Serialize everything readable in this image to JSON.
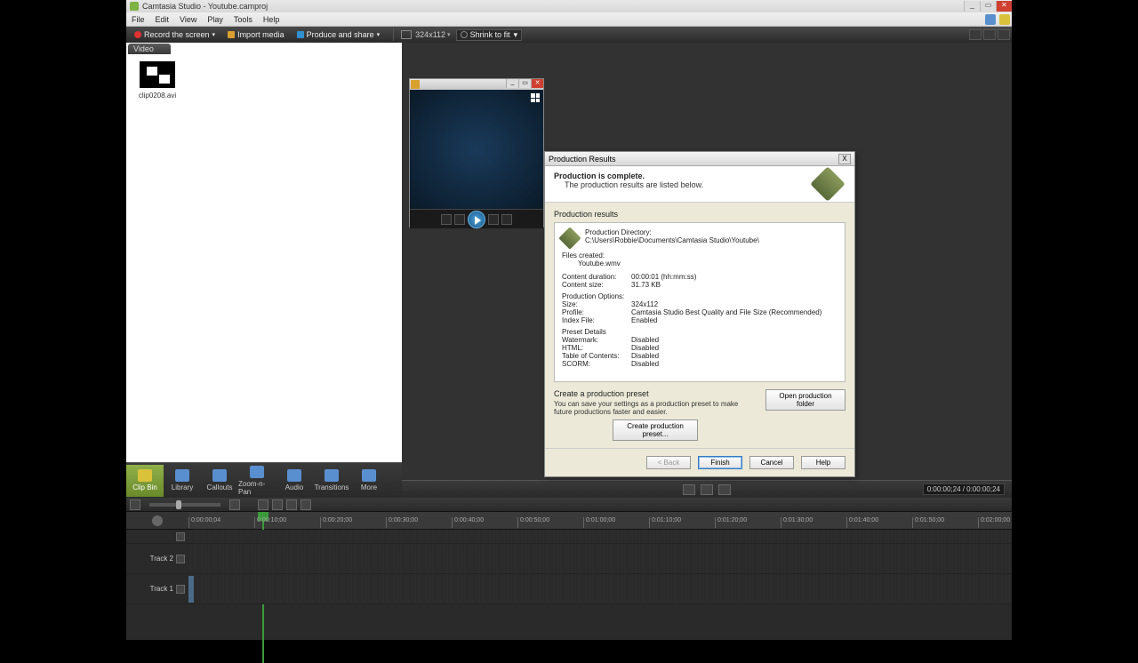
{
  "titlebar": {
    "text": "Camtasia Studio - Youtube.camproj"
  },
  "menu": {
    "file": "File",
    "edit": "Edit",
    "view": "View",
    "play": "Play",
    "tools": "Tools",
    "help": "Help"
  },
  "toolbar": {
    "record": "Record the screen",
    "import": "Import media",
    "produce": "Produce and share",
    "dimensions": "324x112",
    "zoom": "Shrink to fit"
  },
  "clipbin": {
    "tab": "Video",
    "clip_name": "clip0208.avi"
  },
  "tabs": {
    "clipbin": "Clip Bin",
    "library": "Library",
    "callouts": "Callouts",
    "zoom": "Zoom-n-Pan",
    "audio": "Audio",
    "transitions": "Transitions",
    "more": "More"
  },
  "preview": {
    "time": "0:00:00;24 / 0:00:00;24"
  },
  "dialog": {
    "title": "Production Results",
    "heading": "Production is complete.",
    "subheading": "The production results are listed below.",
    "results_label": "Production results",
    "dir_label": "Production Directory:",
    "dir_value": "C:\\Users\\Robbie\\Documents\\Camtasia Studio\\Youtube\\",
    "files_label": "Files created:",
    "files_value": "Youtube.wmv",
    "duration_label": "Content duration:",
    "duration_value": "00:00:01 (hh:mm:ss)",
    "size_label": "Content size:",
    "size_value": "31.73 KB",
    "options_label": "Production Options:",
    "opt_size_label": "Size:",
    "opt_size_value": "324x112",
    "opt_profile_label": "Profile:",
    "opt_profile_value": "Camtasia Studio Best Quality and File Size (Recommended)",
    "opt_index_label": "Index File:",
    "opt_index_value": "Enabled",
    "preset_label": "Preset Details",
    "watermark_label": "Watermark:",
    "watermark_value": "Disabled",
    "html_label": "HTML:",
    "html_value": "Disabled",
    "toc_label": "Table of Contents:",
    "toc_value": "Disabled",
    "scorm_label": "SCORM:",
    "scorm_value": "Disabled",
    "create_preset_heading": "Create a production preset",
    "create_preset_text": "You can save your settings as a production preset to make future productions faster and easier.",
    "open_folder": "Open production folder",
    "create_preset_btn": "Create production preset...",
    "back": "< Back",
    "finish": "Finish",
    "cancel": "Cancel",
    "help": "Help"
  },
  "timeline": {
    "tracks": {
      "t2": "Track 2",
      "t1": "Track 1"
    },
    "ticks": [
      "0:00:00;04",
      "0:00:10;00",
      "0:00:20;00",
      "0:00:30;00",
      "0:00:40;00",
      "0:00:50;00",
      "0:01:00;00",
      "0:01:10;00",
      "0:01:20;00",
      "0:01:30;00",
      "0:01:40;00",
      "0:01:50;00",
      "0:02:00;00"
    ]
  }
}
